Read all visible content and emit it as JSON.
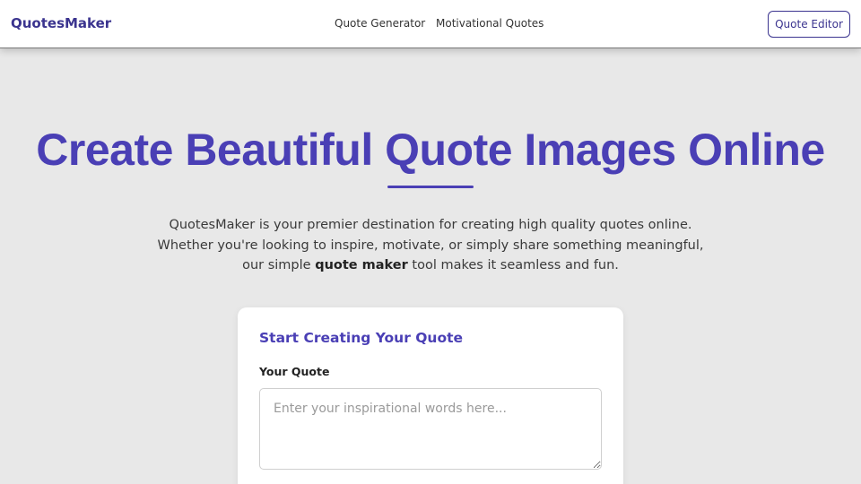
{
  "navbar": {
    "brand": "QuotesMaker",
    "links": [
      {
        "label": "Quote Generator"
      },
      {
        "label": "Motivational Quotes"
      }
    ],
    "cta_label": "Quote Editor"
  },
  "hero": {
    "title": "Create Beautiful Quote Images Online",
    "description_before": "QuotesMaker is your premier destination for creating high quality quotes online. Whether you're looking to inspire, motivate, or simply share something meaningful, our simple ",
    "description_bold": "quote maker",
    "description_after": " tool makes it seamless and fun."
  },
  "form": {
    "title": "Start Creating Your Quote",
    "quote_label": "Your Quote",
    "quote_placeholder": "Enter your inspirational words here...",
    "quote_value": ""
  },
  "colors": {
    "accent": "#4a3fb5",
    "brand": "#3b348f",
    "background": "#e8e8e8"
  }
}
